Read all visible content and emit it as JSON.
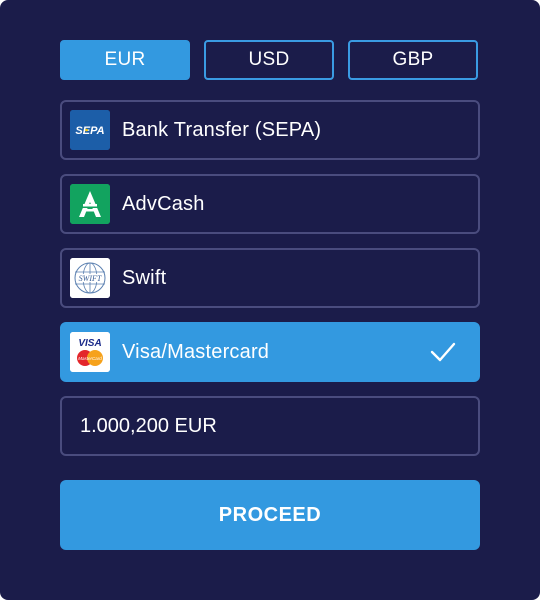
{
  "currencies": [
    {
      "label": "EUR",
      "active": true
    },
    {
      "label": "USD",
      "active": false
    },
    {
      "label": "GBP",
      "active": false
    }
  ],
  "methods": [
    {
      "label": "Bank Transfer (SEPA)",
      "icon": "sepa-logo-icon",
      "logo_text": "SEPA",
      "selected": false
    },
    {
      "label": "AdvCash",
      "icon": "advcash-logo-icon",
      "selected": false
    },
    {
      "label": "Swift",
      "icon": "swift-logo-icon",
      "logo_text": "SWIFT",
      "selected": false
    },
    {
      "label": "Visa/Mastercard",
      "icon": "visa-mastercard-logo-icon",
      "logo_text": "VISA",
      "logo_subtext": "MasterCard",
      "selected": true
    }
  ],
  "amount": {
    "value": "1.000,200 EUR"
  },
  "proceed_label": "PROCEED",
  "colors": {
    "panel": "#1b1c4a",
    "accent": "#3399e0",
    "border": "#4a4c7e",
    "advcash": "#12a35f",
    "sepa": "#1c5ea8"
  }
}
